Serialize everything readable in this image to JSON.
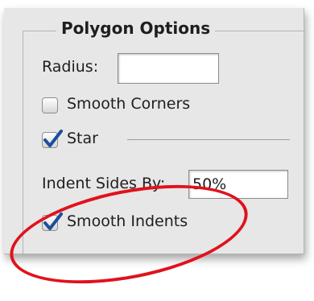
{
  "group_title": "Polygon Options",
  "radius": {
    "label": "Radius:",
    "value": ""
  },
  "smooth_corners": {
    "label": "Smooth Corners",
    "checked": false
  },
  "star": {
    "label": "Star",
    "checked": true
  },
  "indent": {
    "label": "Indent Sides By:",
    "value": "50%"
  },
  "smooth_indents": {
    "label": "Smooth Indents",
    "checked": true
  },
  "colors": {
    "panel": "#e7e7e7",
    "check": "#1a4f9a",
    "highlight_oval": "#e0121c"
  }
}
